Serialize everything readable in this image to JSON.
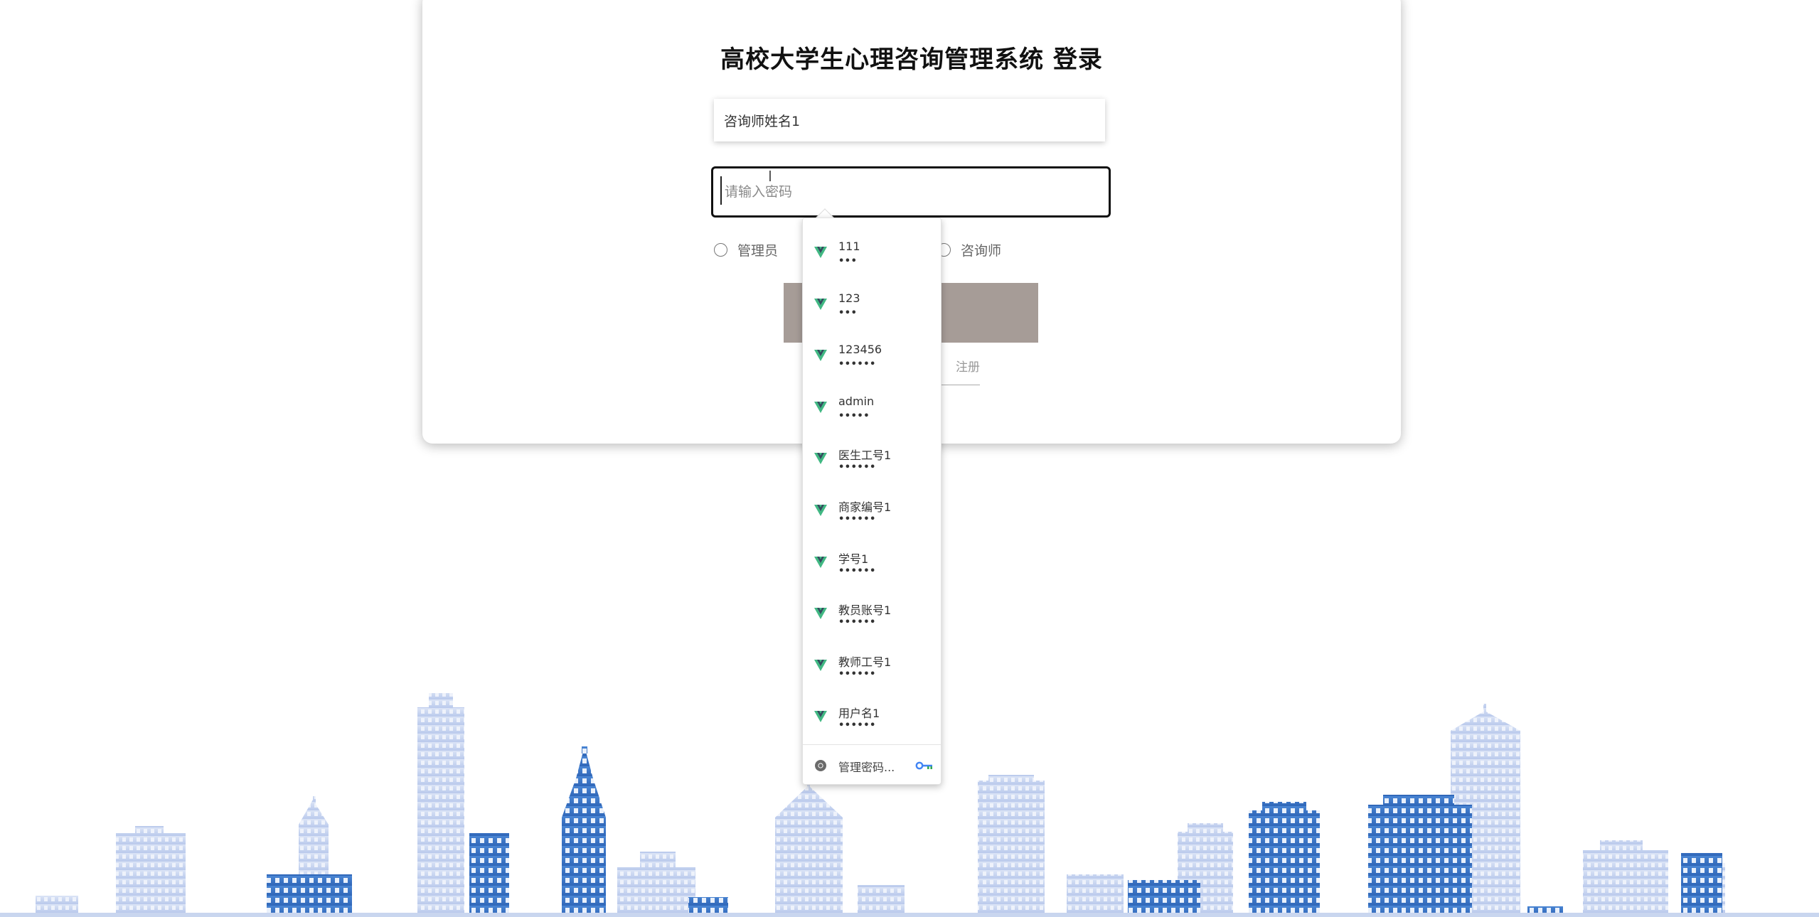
{
  "login": {
    "title": "高校大学生心理咨询管理系统 登录",
    "username_value": "咨询师姓名1",
    "password_placeholder": "请输入密码",
    "roles": [
      {
        "label": "管理员",
        "selected": false
      },
      {
        "label": "咨询师",
        "selected": false
      }
    ],
    "register_link": "注册"
  },
  "autofill": {
    "items": [
      {
        "username": "111",
        "password_mask": "•••"
      },
      {
        "username": "123",
        "password_mask": "•••"
      },
      {
        "username": "123456",
        "password_mask": "••••••"
      },
      {
        "username": "admin",
        "password_mask": "•••••"
      },
      {
        "username": "医生工号1",
        "password_mask": "••••••"
      },
      {
        "username": "商家编号1",
        "password_mask": "••••••"
      },
      {
        "username": "学号1",
        "password_mask": "••••••"
      },
      {
        "username": "教员账号1",
        "password_mask": "••••••"
      },
      {
        "username": "教师工号1",
        "password_mask": "••••••"
      },
      {
        "username": "用户名1",
        "password_mask": "••••••"
      }
    ],
    "item_icon": "vue-logo-icon",
    "manage_label": "管理密码...",
    "manage_icon": "chrome-icon",
    "key_icon": "key-icon"
  },
  "colors": {
    "login_button": "#a69c97",
    "skyline_light": "#c5d3ef",
    "skyline_dark": "#3f79c9",
    "vue_green": "#41b883",
    "vue_dark": "#35495e"
  }
}
